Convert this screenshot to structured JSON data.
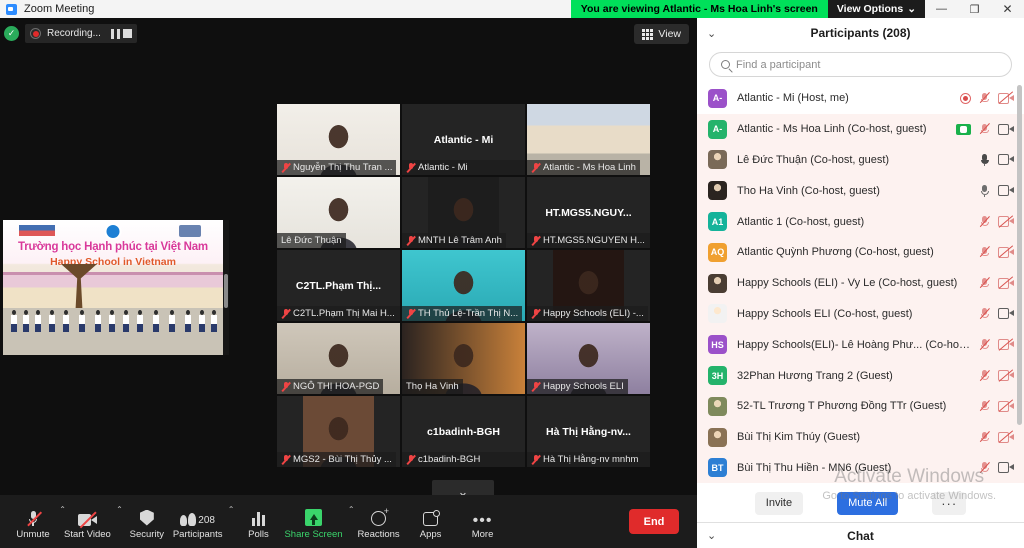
{
  "window": {
    "title": "Zoom Meeting",
    "logo_icon": "zoom-logo-icon",
    "share_banner": "You are viewing Atlantic - Ms Hoa Linh's screen",
    "view_options": "View Options",
    "view_options_caret": "⌄",
    "minimize": "—",
    "maximize": "❐",
    "close": "✕"
  },
  "stage": {
    "recording": {
      "shield_icon": "shield-check-icon",
      "shield_glyph": "✓",
      "label": "Recording...",
      "pause_icon": "pause-icon",
      "stop_icon": "stop-icon"
    },
    "view_button": {
      "label": "View",
      "icon": "grid-view-icon"
    },
    "shared_screen": {
      "title_vn": "Trường học Hạnh phúc tại Việt Nam",
      "title_en": "Happy School in Vietnam"
    },
    "scroll_down_icon": "chevron-down-icon",
    "scroll_down_glyph": "⌄"
  },
  "tiles": [
    [
      {
        "name": "Nguyễn Thị Thu Tran ...",
        "center": "",
        "video": true,
        "muted": true,
        "active": false,
        "kind": "person-light"
      },
      {
        "name": "Atlantic - Mi",
        "center": "Atlantic - Mi",
        "video": false,
        "muted": true,
        "active": false,
        "kind": "none"
      },
      {
        "name": "Atlantic - Ms Hoa Linh",
        "center": "",
        "video": true,
        "muted": true,
        "active": false,
        "kind": "share-preview"
      }
    ],
    [
      {
        "name": "Lê Đức Thuận",
        "center": "",
        "video": true,
        "muted": false,
        "active": true,
        "kind": "person-suit"
      },
      {
        "name": "MNTH Lê Trâm Anh",
        "center": "",
        "video": true,
        "muted": true,
        "active": false,
        "kind": "phone-screen"
      },
      {
        "name": "HT.MGS5.NGUYEN H...",
        "center": "HT.MGS5.NGUY...",
        "video": false,
        "muted": true,
        "active": false,
        "kind": "none"
      }
    ],
    [
      {
        "name": "C2TL.Phạm Thị Mai H...",
        "center": "C2TL.Phạm  Thị...",
        "video": false,
        "muted": true,
        "active": false,
        "kind": "none"
      },
      {
        "name": "TH Thủ Lệ-Trần Thị N...",
        "center": "",
        "video": true,
        "muted": true,
        "active": false,
        "kind": "teal-room"
      },
      {
        "name": "Happy Schools (ELI) -...",
        "center": "",
        "video": true,
        "muted": true,
        "active": false,
        "kind": "stage-woman"
      }
    ],
    [
      {
        "name": "NGÔ THỊ HOA-PGD",
        "center": "",
        "video": true,
        "muted": true,
        "active": false,
        "kind": "office"
      },
      {
        "name": "Thọ Ha Vinh",
        "center": "",
        "video": true,
        "muted": false,
        "active": false,
        "kind": "elder"
      },
      {
        "name": "Happy Schools ELI",
        "center": "",
        "video": true,
        "muted": true,
        "active": false,
        "kind": "purple-room"
      }
    ],
    [
      {
        "name": "MGS2 - Bùi Thị Thủy ...",
        "center": "",
        "video": true,
        "muted": true,
        "active": false,
        "kind": "woman-door"
      },
      {
        "name": "c1badinh-BGH",
        "center": "c1badinh-BGH",
        "video": false,
        "muted": true,
        "active": false,
        "kind": "none"
      },
      {
        "name": "Hà Thị Hằng-nv mnhm",
        "center": "Hà  Thị  Hằng-nv...",
        "video": false,
        "muted": true,
        "active": false,
        "kind": "none"
      }
    ]
  ],
  "toolbar": [
    {
      "label": "Unmute",
      "icon": "microphone-off-icon",
      "caret": true,
      "green": false
    },
    {
      "label": "Start Video",
      "icon": "camera-off-icon",
      "caret": true,
      "green": false
    },
    {
      "label": "Security",
      "icon": "shield-icon",
      "caret": false,
      "green": false
    },
    {
      "label": "Participants",
      "icon": "participants-icon",
      "caret": true,
      "green": false,
      "count": "208"
    },
    {
      "label": "Polls",
      "icon": "polls-icon",
      "caret": false,
      "green": false
    },
    {
      "label": "Share Screen",
      "icon": "share-screen-icon",
      "caret": true,
      "green": true
    },
    {
      "label": "Reactions",
      "icon": "reactions-icon",
      "caret": false,
      "green": false
    },
    {
      "label": "Apps",
      "icon": "apps-icon",
      "caret": false,
      "green": false
    },
    {
      "label": "More",
      "icon": "more-dots-icon",
      "caret": false,
      "green": false
    }
  ],
  "end_button": "End",
  "panel": {
    "collapse_icon": "chevron-down-icon",
    "collapse_glyph": "⌄",
    "title": "Participants (208)",
    "search": {
      "placeholder": "Find a participant",
      "icon": "search-icon",
      "value": ""
    },
    "participants": [
      {
        "name": "Atlantic - Mi (Host, me)",
        "initials": "A-",
        "color": "#9b51c9",
        "photo": false,
        "me": true,
        "icons": [
          "record-indicator",
          "mic-off",
          "camera-off"
        ]
      },
      {
        "name": "Atlantic - Ms Hoa Linh (Co-host, guest)",
        "initials": "A-",
        "color": "#24b36b",
        "photo": false,
        "me": false,
        "icons": [
          "green-share",
          "mic-off",
          "camera-on"
        ]
      },
      {
        "name": "Lê Đức Thuận (Co-host, guest)",
        "initials": "",
        "color": "#7a6a58",
        "photo": true,
        "me": false,
        "icons": [
          "mic-on-dark",
          "camera-on"
        ]
      },
      {
        "name": "Tho Ha Vinh (Co-host, guest)",
        "initials": "",
        "color": "#2b2420",
        "photo": true,
        "me": false,
        "icons": [
          "mic-on",
          "camera-on"
        ]
      },
      {
        "name": "Atlantic 1 (Co-host, guest)",
        "initials": "A1",
        "color": "#15b39a",
        "photo": false,
        "me": false,
        "icons": [
          "mic-off",
          "camera-off"
        ]
      },
      {
        "name": "Atlantic Quỳnh Phương (Co-host, guest)",
        "initials": "AQ",
        "color": "#f0a030",
        "photo": false,
        "me": false,
        "icons": [
          "mic-off",
          "camera-off"
        ]
      },
      {
        "name": "Happy Schools (ELI) - Vy Le (Co-host, guest)",
        "initials": "",
        "color": "#4a3d33",
        "photo": true,
        "me": false,
        "icons": [
          "mic-off",
          "camera-off"
        ]
      },
      {
        "name": "Happy Schools ELI (Co-host, guest)",
        "initials": "",
        "color": "#f2f2f2",
        "photo": true,
        "me": false,
        "icons": [
          "mic-off",
          "camera-on"
        ]
      },
      {
        "name": "Happy Schools(ELI)- Lê Hoàng Phư... (Co-host, guest)",
        "initials": "HS",
        "color": "#9b51c9",
        "photo": false,
        "me": false,
        "icons": [
          "mic-off",
          "camera-off"
        ]
      },
      {
        "name": "32Phan Hương Trang 2 (Guest)",
        "initials": "3H",
        "color": "#24b36b",
        "photo": false,
        "me": false,
        "icons": [
          "mic-off",
          "camera-off"
        ]
      },
      {
        "name": "52-TL Trương T Phương Đồng TTr (Guest)",
        "initials": "",
        "color": "#7f8a5c",
        "photo": true,
        "me": false,
        "icons": [
          "mic-off",
          "camera-off"
        ]
      },
      {
        "name": "Bùi Thị Kim Thúy (Guest)",
        "initials": "",
        "color": "#8a7255",
        "photo": true,
        "me": false,
        "icons": [
          "mic-off",
          "camera-off"
        ]
      },
      {
        "name": "Bùi Thị Thu Hiền - MN6 (Guest)",
        "initials": "BT",
        "color": "#2d7fd4",
        "photo": false,
        "me": false,
        "icons": [
          "mic-off",
          "camera-on"
        ]
      }
    ],
    "footer": {
      "invite": "Invite",
      "mute_all": "Mute All",
      "more": "···"
    },
    "chat": {
      "label": "Chat",
      "collapse_glyph": "⌄",
      "collapse_icon": "chevron-down-icon"
    }
  },
  "watermark": {
    "line1": "Activate Windows",
    "line2": "Go to Settings to activate Windows."
  }
}
